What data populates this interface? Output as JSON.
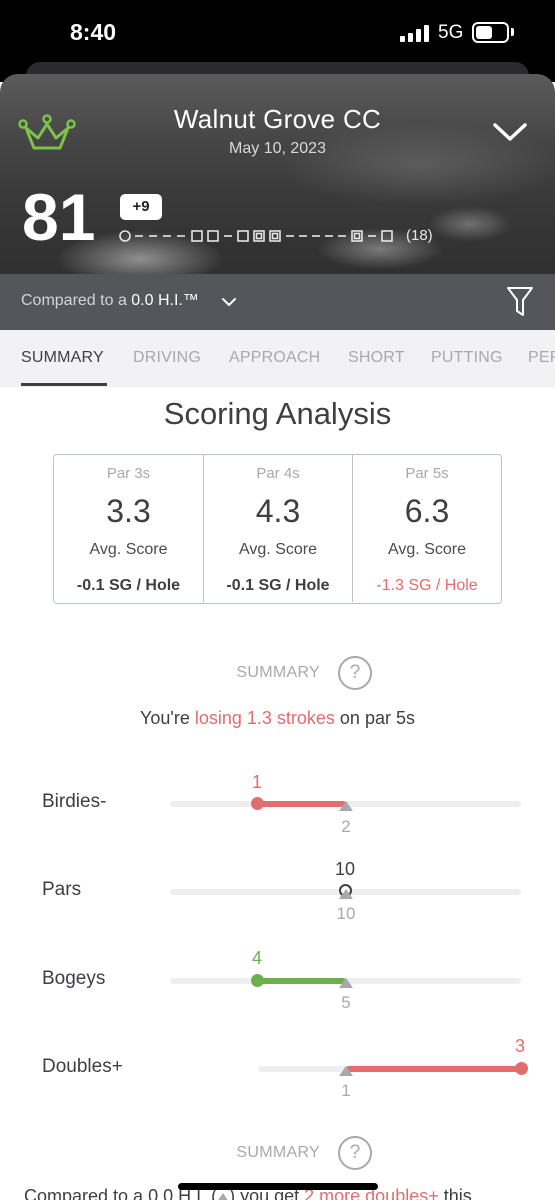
{
  "status_bar": {
    "time": "8:40",
    "network": "5G"
  },
  "round": {
    "course": "Walnut Grove CC",
    "date": "May 10, 2023",
    "score": "81",
    "to_par": "+9",
    "holes": "(18)"
  },
  "compare": {
    "prefix": "Compared to a ",
    "handicap": "0.0 H.I.™"
  },
  "tabs": [
    {
      "label": "SUMMARY",
      "active": true
    },
    {
      "label": "DRIVING"
    },
    {
      "label": "APPROACH"
    },
    {
      "label": "SHORT"
    },
    {
      "label": "PUTTING"
    },
    {
      "label": "PERFORMANCE"
    }
  ],
  "section_title": "Scoring Analysis",
  "par_stats": [
    {
      "label": "Par 3s",
      "avg": "3.3",
      "avg_label": "Avg. Score",
      "sg": "-0.1 SG / Hole"
    },
    {
      "label": "Par 4s",
      "avg": "4.3",
      "avg_label": "Avg. Score",
      "sg": "-0.1 SG / Hole"
    },
    {
      "label": "Par 5s",
      "avg": "6.3",
      "avg_label": "Avg. Score",
      "sg": "-1.3 SG / Hole"
    }
  ],
  "summary": {
    "label": "SUMMARY",
    "help": "?",
    "text_pre": "You're ",
    "text_highlight": "losing 1.3 strokes",
    "text_post": " on par 5s"
  },
  "distribution": [
    {
      "label": "Birdies-",
      "value": "1",
      "reference": "2",
      "status": "worse"
    },
    {
      "label": "Pars",
      "value": "10",
      "reference": "10",
      "status": "equal"
    },
    {
      "label": "Bogeys",
      "value": "4",
      "reference": "5",
      "status": "better"
    },
    {
      "label": "Doubles+",
      "value": "3",
      "reference": "1",
      "status": "worse"
    }
  ],
  "summary2": {
    "label": "SUMMARY",
    "help": "?",
    "text_pre": "Compared to a 0.0 H.I. (",
    "text_mid": ") you get ",
    "text_highlight": "2 more doubles+",
    "text_post": " this"
  },
  "colors": {
    "red": "#e26d6d",
    "green": "#6ab04c",
    "crown": "#7dc24b",
    "dark": "#3e3e45",
    "muted": "#a8a8b0"
  },
  "icons": [
    "crown-logo-icon",
    "chevron-down-icon",
    "filter-icon",
    "help-icon",
    "reference-triangle-icon"
  ]
}
